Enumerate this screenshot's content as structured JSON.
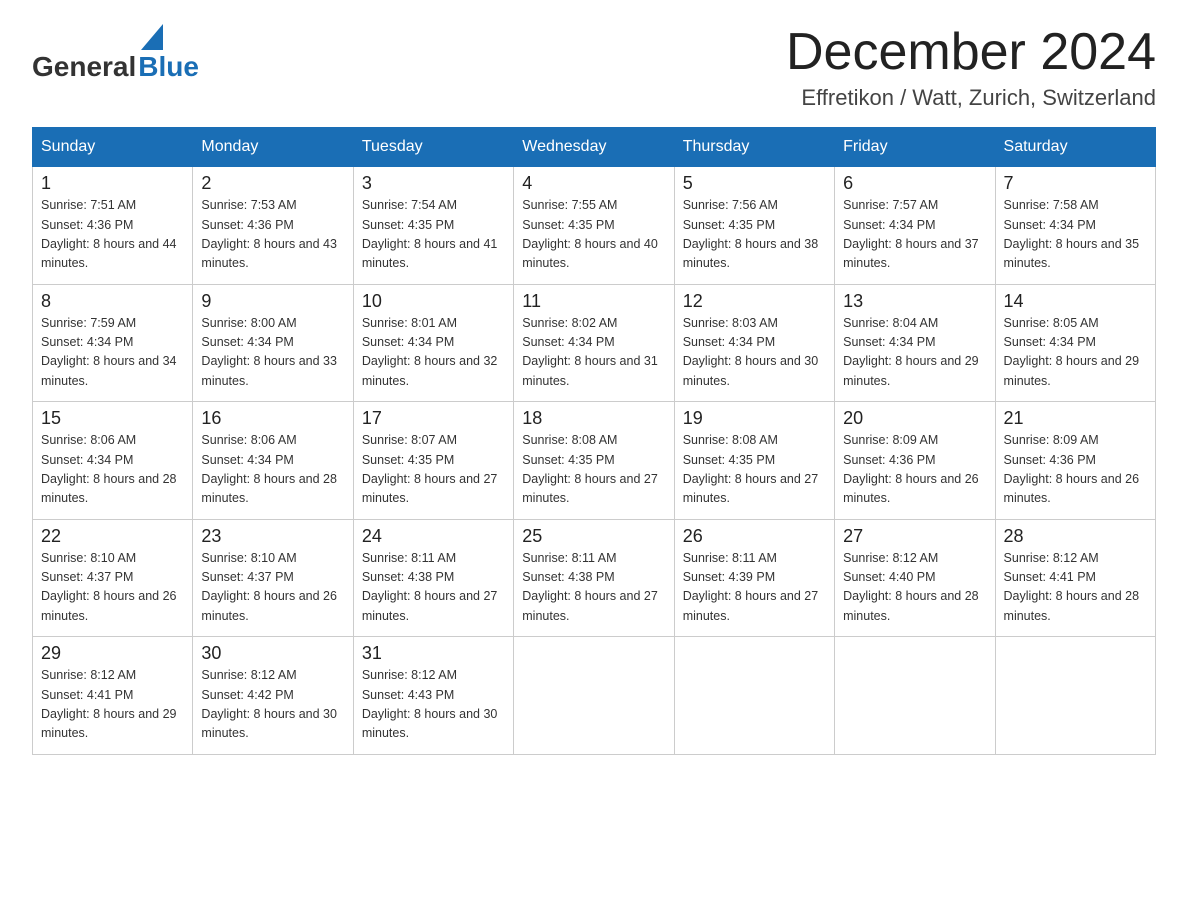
{
  "logo": {
    "general": "General",
    "blue": "Blue",
    "arrow": "▶"
  },
  "header": {
    "title": "December 2024",
    "subtitle": "Effretikon / Watt, Zurich, Switzerland"
  },
  "days_of_week": [
    "Sunday",
    "Monday",
    "Tuesday",
    "Wednesday",
    "Thursday",
    "Friday",
    "Saturday"
  ],
  "weeks": [
    [
      {
        "day": "1",
        "sunrise": "Sunrise: 7:51 AM",
        "sunset": "Sunset: 4:36 PM",
        "daylight": "Daylight: 8 hours and 44 minutes."
      },
      {
        "day": "2",
        "sunrise": "Sunrise: 7:53 AM",
        "sunset": "Sunset: 4:36 PM",
        "daylight": "Daylight: 8 hours and 43 minutes."
      },
      {
        "day": "3",
        "sunrise": "Sunrise: 7:54 AM",
        "sunset": "Sunset: 4:35 PM",
        "daylight": "Daylight: 8 hours and 41 minutes."
      },
      {
        "day": "4",
        "sunrise": "Sunrise: 7:55 AM",
        "sunset": "Sunset: 4:35 PM",
        "daylight": "Daylight: 8 hours and 40 minutes."
      },
      {
        "day": "5",
        "sunrise": "Sunrise: 7:56 AM",
        "sunset": "Sunset: 4:35 PM",
        "daylight": "Daylight: 8 hours and 38 minutes."
      },
      {
        "day": "6",
        "sunrise": "Sunrise: 7:57 AM",
        "sunset": "Sunset: 4:34 PM",
        "daylight": "Daylight: 8 hours and 37 minutes."
      },
      {
        "day": "7",
        "sunrise": "Sunrise: 7:58 AM",
        "sunset": "Sunset: 4:34 PM",
        "daylight": "Daylight: 8 hours and 35 minutes."
      }
    ],
    [
      {
        "day": "8",
        "sunrise": "Sunrise: 7:59 AM",
        "sunset": "Sunset: 4:34 PM",
        "daylight": "Daylight: 8 hours and 34 minutes."
      },
      {
        "day": "9",
        "sunrise": "Sunrise: 8:00 AM",
        "sunset": "Sunset: 4:34 PM",
        "daylight": "Daylight: 8 hours and 33 minutes."
      },
      {
        "day": "10",
        "sunrise": "Sunrise: 8:01 AM",
        "sunset": "Sunset: 4:34 PM",
        "daylight": "Daylight: 8 hours and 32 minutes."
      },
      {
        "day": "11",
        "sunrise": "Sunrise: 8:02 AM",
        "sunset": "Sunset: 4:34 PM",
        "daylight": "Daylight: 8 hours and 31 minutes."
      },
      {
        "day": "12",
        "sunrise": "Sunrise: 8:03 AM",
        "sunset": "Sunset: 4:34 PM",
        "daylight": "Daylight: 8 hours and 30 minutes."
      },
      {
        "day": "13",
        "sunrise": "Sunrise: 8:04 AM",
        "sunset": "Sunset: 4:34 PM",
        "daylight": "Daylight: 8 hours and 29 minutes."
      },
      {
        "day": "14",
        "sunrise": "Sunrise: 8:05 AM",
        "sunset": "Sunset: 4:34 PM",
        "daylight": "Daylight: 8 hours and 29 minutes."
      }
    ],
    [
      {
        "day": "15",
        "sunrise": "Sunrise: 8:06 AM",
        "sunset": "Sunset: 4:34 PM",
        "daylight": "Daylight: 8 hours and 28 minutes."
      },
      {
        "day": "16",
        "sunrise": "Sunrise: 8:06 AM",
        "sunset": "Sunset: 4:34 PM",
        "daylight": "Daylight: 8 hours and 28 minutes."
      },
      {
        "day": "17",
        "sunrise": "Sunrise: 8:07 AM",
        "sunset": "Sunset: 4:35 PM",
        "daylight": "Daylight: 8 hours and 27 minutes."
      },
      {
        "day": "18",
        "sunrise": "Sunrise: 8:08 AM",
        "sunset": "Sunset: 4:35 PM",
        "daylight": "Daylight: 8 hours and 27 minutes."
      },
      {
        "day": "19",
        "sunrise": "Sunrise: 8:08 AM",
        "sunset": "Sunset: 4:35 PM",
        "daylight": "Daylight: 8 hours and 27 minutes."
      },
      {
        "day": "20",
        "sunrise": "Sunrise: 8:09 AM",
        "sunset": "Sunset: 4:36 PM",
        "daylight": "Daylight: 8 hours and 26 minutes."
      },
      {
        "day": "21",
        "sunrise": "Sunrise: 8:09 AM",
        "sunset": "Sunset: 4:36 PM",
        "daylight": "Daylight: 8 hours and 26 minutes."
      }
    ],
    [
      {
        "day": "22",
        "sunrise": "Sunrise: 8:10 AM",
        "sunset": "Sunset: 4:37 PM",
        "daylight": "Daylight: 8 hours and 26 minutes."
      },
      {
        "day": "23",
        "sunrise": "Sunrise: 8:10 AM",
        "sunset": "Sunset: 4:37 PM",
        "daylight": "Daylight: 8 hours and 26 minutes."
      },
      {
        "day": "24",
        "sunrise": "Sunrise: 8:11 AM",
        "sunset": "Sunset: 4:38 PM",
        "daylight": "Daylight: 8 hours and 27 minutes."
      },
      {
        "day": "25",
        "sunrise": "Sunrise: 8:11 AM",
        "sunset": "Sunset: 4:38 PM",
        "daylight": "Daylight: 8 hours and 27 minutes."
      },
      {
        "day": "26",
        "sunrise": "Sunrise: 8:11 AM",
        "sunset": "Sunset: 4:39 PM",
        "daylight": "Daylight: 8 hours and 27 minutes."
      },
      {
        "day": "27",
        "sunrise": "Sunrise: 8:12 AM",
        "sunset": "Sunset: 4:40 PM",
        "daylight": "Daylight: 8 hours and 28 minutes."
      },
      {
        "day": "28",
        "sunrise": "Sunrise: 8:12 AM",
        "sunset": "Sunset: 4:41 PM",
        "daylight": "Daylight: 8 hours and 28 minutes."
      }
    ],
    [
      {
        "day": "29",
        "sunrise": "Sunrise: 8:12 AM",
        "sunset": "Sunset: 4:41 PM",
        "daylight": "Daylight: 8 hours and 29 minutes."
      },
      {
        "day": "30",
        "sunrise": "Sunrise: 8:12 AM",
        "sunset": "Sunset: 4:42 PM",
        "daylight": "Daylight: 8 hours and 30 minutes."
      },
      {
        "day": "31",
        "sunrise": "Sunrise: 8:12 AM",
        "sunset": "Sunset: 4:43 PM",
        "daylight": "Daylight: 8 hours and 30 minutes."
      },
      null,
      null,
      null,
      null
    ]
  ]
}
